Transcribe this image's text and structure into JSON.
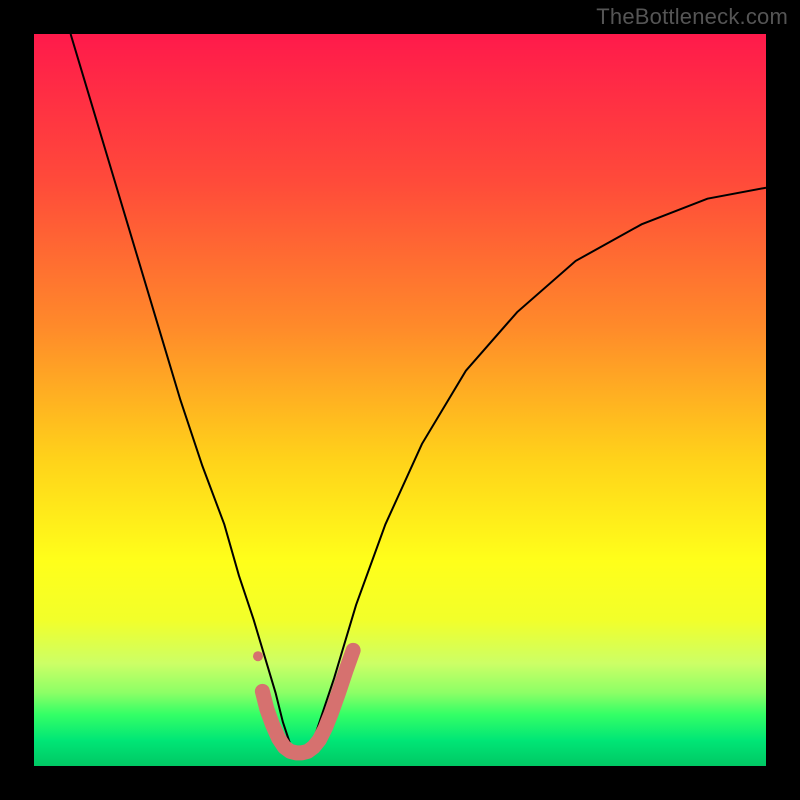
{
  "watermark": "TheBottleneck.com",
  "chart_data": {
    "type": "line",
    "title": "",
    "xlabel": "",
    "ylabel": "",
    "xlim": [
      0,
      100
    ],
    "ylim": [
      0,
      100
    ],
    "gradient_stops": [
      {
        "offset": 0.0,
        "color": "#ff1a4b"
      },
      {
        "offset": 0.2,
        "color": "#ff4a3a"
      },
      {
        "offset": 0.4,
        "color": "#ff8a2a"
      },
      {
        "offset": 0.58,
        "color": "#ffd21a"
      },
      {
        "offset": 0.72,
        "color": "#ffff1a"
      },
      {
        "offset": 0.8,
        "color": "#f2ff2a"
      },
      {
        "offset": 0.86,
        "color": "#ccff66"
      },
      {
        "offset": 0.9,
        "color": "#8cff66"
      },
      {
        "offset": 0.93,
        "color": "#33ff66"
      },
      {
        "offset": 0.965,
        "color": "#00e676"
      },
      {
        "offset": 1.0,
        "color": "#00c864"
      }
    ],
    "series": [
      {
        "name": "bottleneck-curve",
        "color": "#000000",
        "width": 2,
        "x": [
          5,
          8,
          11,
          14,
          17,
          20,
          23,
          26,
          28,
          30,
          31.5,
          33,
          34,
          35,
          36,
          37,
          38,
          39,
          41,
          44,
          48,
          53,
          59,
          66,
          74,
          83,
          92,
          100
        ],
        "y": [
          100,
          90,
          80,
          70,
          60,
          50,
          41,
          33,
          26,
          20,
          15,
          10,
          6,
          3,
          1.5,
          1.5,
          3,
          6,
          12,
          22,
          33,
          44,
          54,
          62,
          69,
          74,
          77.5,
          79
        ]
      }
    ],
    "markers": {
      "name": "optimal-band",
      "color": "#d6716f",
      "dot": {
        "x": 30.6,
        "y": 15,
        "r": 5
      },
      "worm": [
        {
          "x": 31.2,
          "y": 10.2
        },
        {
          "x": 31.8,
          "y": 7.8
        },
        {
          "x": 32.6,
          "y": 5.6
        },
        {
          "x": 33.4,
          "y": 3.8
        },
        {
          "x": 34.2,
          "y": 2.6
        },
        {
          "x": 35.0,
          "y": 2.0
        },
        {
          "x": 35.8,
          "y": 1.8
        },
        {
          "x": 36.6,
          "y": 1.8
        },
        {
          "x": 37.4,
          "y": 2.0
        },
        {
          "x": 38.2,
          "y": 2.6
        },
        {
          "x": 39.0,
          "y": 3.6
        },
        {
          "x": 39.8,
          "y": 5.2
        },
        {
          "x": 40.6,
          "y": 7.2
        },
        {
          "x": 41.6,
          "y": 10.0
        },
        {
          "x": 42.6,
          "y": 13.0
        },
        {
          "x": 43.6,
          "y": 15.8
        }
      ],
      "worm_width": 15
    }
  }
}
